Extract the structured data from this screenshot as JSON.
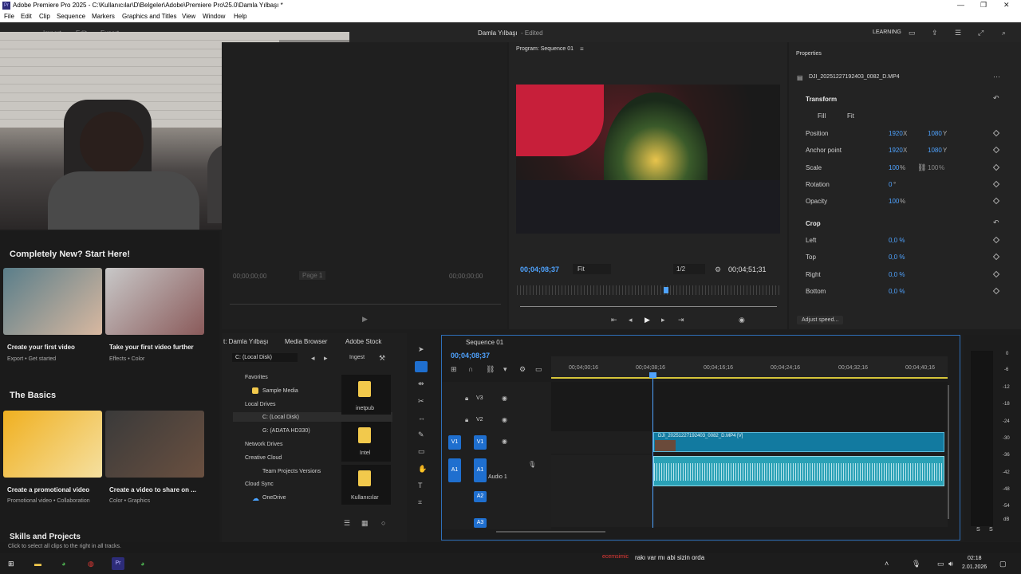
{
  "window": {
    "title": "Adobe Premiere Pro 2025 - C:\\Kullanıcılar\\D\\Belgeler\\Adobe\\Premiere Pro\\25.0\\Damla Yılbaşı *",
    "app_icon": "Pr"
  },
  "menu": [
    "File",
    "Edit",
    "Clip",
    "Sequence",
    "Markers",
    "Graphics and Titles",
    "View",
    "Window",
    "Help"
  ],
  "header": {
    "ws_tabs": [
      "Import",
      "Edit",
      "Export"
    ],
    "project_title": "Damla Yılbaşı",
    "status": "- Edited",
    "learning": "LEARNING"
  },
  "source": {
    "tc_left": "00;00;00;00",
    "tc_right": "00;00;00;00",
    "page": "Page 1"
  },
  "program": {
    "tab": "Program: Sequence 01",
    "tc": "00;04;08;37",
    "fit": "Fit",
    "res": "1/2",
    "duration": "00;04;51;31"
  },
  "properties": {
    "tab": "Properties",
    "clip": "DJI_20251227192403_0082_D.MP4",
    "transform": "Transform",
    "fill": "Fill",
    "fit": "Fit",
    "rows": [
      {
        "label": "Position",
        "x": "1920",
        "xu": "X",
        "y": "1080",
        "yu": "Y"
      },
      {
        "label": "Anchor point",
        "x": "1920",
        "xu": "X",
        "y": "1080",
        "yu": "Y"
      },
      {
        "label": "Scale",
        "x": "100",
        "xu": "%",
        "y": "100",
        "yu": "%"
      },
      {
        "label": "Rotation",
        "x": "0",
        "xu": "°"
      },
      {
        "label": "Opacity",
        "x": "100",
        "xu": "%"
      }
    ],
    "crop": "Crop",
    "crop_rows": [
      {
        "label": "Left",
        "v": "0,0 %"
      },
      {
        "label": "Top",
        "v": "0,0 %"
      },
      {
        "label": "Right",
        "v": "0,0 %"
      },
      {
        "label": "Bottom",
        "v": "0,0 %"
      }
    ],
    "adjust": "Adjust speed..."
  },
  "learn": {
    "heading": "Completely New? Start Here!",
    "cards": [
      {
        "title": "Create your first video",
        "sub": "Export • Get started"
      },
      {
        "title": "Take your first video further",
        "sub": "Effects • Color"
      }
    ],
    "basics": "The Basics",
    "cards2": [
      {
        "title": "Create a promotional video",
        "sub": "Promotional video • Collaboration"
      },
      {
        "title": "Create a video to share on ...",
        "sub": "Color • Graphics"
      }
    ],
    "skills": "Skills and Projects"
  },
  "project": {
    "tabs": [
      "t: Damla Yılbaşı",
      "Media Browser",
      "Adobe Stock"
    ],
    "drive": "C: (Local Disk)",
    "ingest": "Ingest",
    "tree": [
      {
        "label": "Favorites",
        "level": 0,
        "open": true
      },
      {
        "label": "Sample Media",
        "level": 1,
        "icon": "folder"
      },
      {
        "label": "Local Drives",
        "level": 0,
        "open": true
      },
      {
        "label": "C: (Local Disk)",
        "level": 1,
        "icon": "drive",
        "selected": true
      },
      {
        "label": "G: (ADATA HD330)",
        "level": 1,
        "icon": "drive"
      },
      {
        "label": "Network Drives",
        "level": 0,
        "open": true
      },
      {
        "label": "Creative Cloud",
        "level": 0,
        "open": true
      },
      {
        "label": "Team Projects Versions",
        "level": 1,
        "icon": "team"
      },
      {
        "label": "Cloud Sync",
        "level": 0,
        "open": true
      },
      {
        "label": "OneDrive",
        "level": 1,
        "icon": "cloud"
      }
    ],
    "folders": [
      "inetpub",
      "Intel",
      "Kullanıcılar"
    ]
  },
  "timeline": {
    "tab": "Sequence 01",
    "tc": "00;04;08;37",
    "ruler": [
      "00;04;00;16",
      "00;04;08;16",
      "00;04;16;16",
      "00;04;24;16",
      "00;04;32;16",
      "00;04;40;16"
    ],
    "tracks": [
      "V3",
      "V2",
      "V1",
      "A1",
      "A2",
      "A3"
    ],
    "audio_name": "Audio 1",
    "clip_v": "DJI_20251227192403_0082_D.MP4 [V]",
    "meter": [
      "0",
      "-6",
      "-12",
      "-18",
      "-24",
      "-30",
      "-36",
      "-42",
      "-48",
      "-54",
      "dB"
    ],
    "meter_sr": [
      "S",
      "S"
    ]
  },
  "status": {
    "hint": "Click to select all clips to the right in all tracks.",
    "chat_user": "ecemsimic",
    "chat_msg": "rakı var mı abi sizin orda"
  },
  "taskbar": {
    "time": "02:18",
    "date": "2.01.2026"
  },
  "colors": {
    "accent": "#1f6fcf",
    "audio_clip": "#2aa1b6",
    "video_clip": "#127aa0"
  }
}
